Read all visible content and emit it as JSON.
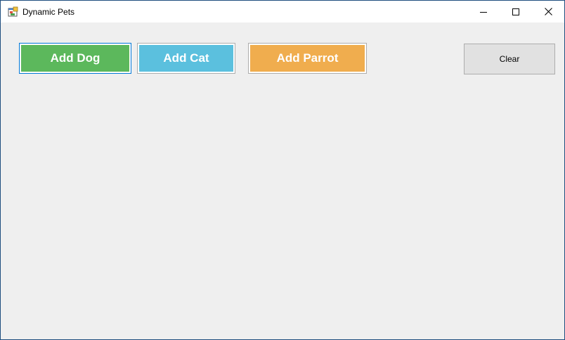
{
  "window": {
    "title": "Dynamic Pets",
    "icons": {
      "app": "app-window-icon",
      "minimize": "minimize-icon",
      "maximize": "maximize-icon",
      "close": "close-icon"
    }
  },
  "buttons": {
    "add_dog": {
      "label": "Add Dog",
      "color": "#5cb85c"
    },
    "add_cat": {
      "label": "Add Cat",
      "color": "#5bc0de"
    },
    "add_parrot": {
      "label": "Add Parrot",
      "color": "#f0ad4e"
    },
    "clear": {
      "label": "Clear"
    }
  },
  "colors": {
    "client_background": "#efefef",
    "window_border": "#1f4e7f",
    "focus_border": "#0078d7"
  }
}
